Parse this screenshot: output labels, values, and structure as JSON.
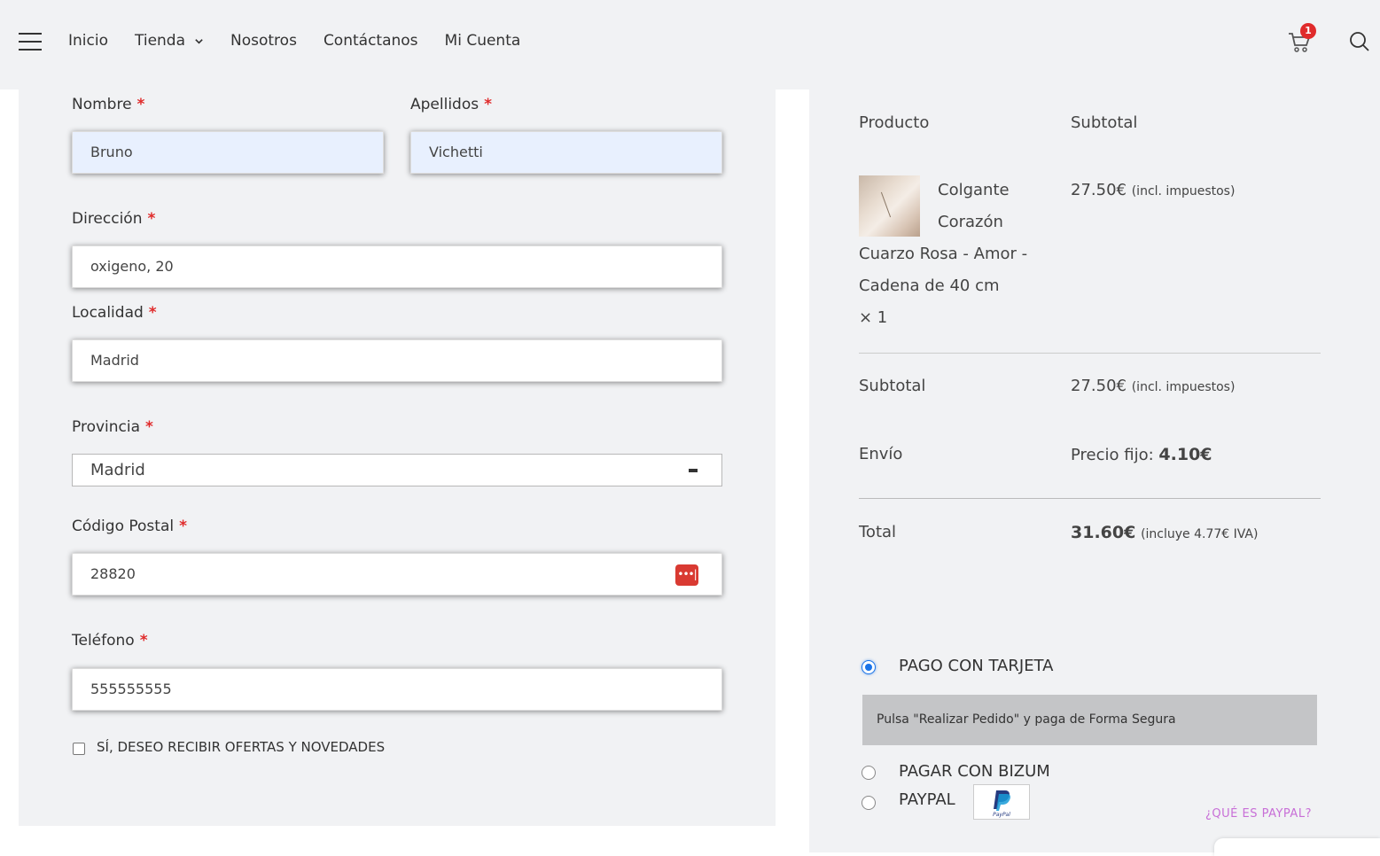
{
  "header": {
    "nav": [
      {
        "label": "Inicio"
      },
      {
        "label": "Tienda"
      },
      {
        "label": "Nosotros"
      },
      {
        "label": "Contáctanos"
      },
      {
        "label": "Mi Cuenta"
      }
    ],
    "cart_count": "1"
  },
  "form": {
    "nombre": {
      "label": "Nombre",
      "value": "Bruno"
    },
    "apellidos": {
      "label": "Apellidos",
      "value": "Vichetti"
    },
    "direccion": {
      "label": "Dirección",
      "value": "oxigeno, 20"
    },
    "localidad": {
      "label": "Localidad",
      "value": "Madrid"
    },
    "provincia": {
      "label": "Provincia",
      "value": "Madrid"
    },
    "codigo_postal": {
      "label": "Código Postal",
      "value": "28820"
    },
    "telefono": {
      "label": "Teléfono",
      "value": "555555555"
    },
    "required_mark": "*",
    "newsletter_label": "SÍ, DESEO RECIBIR OFERTAS Y NOVEDADES",
    "password_icon_text": "•••|"
  },
  "order": {
    "col_product": "Producto",
    "col_subtotal": "Subtotal",
    "product_lines": [
      "Colgante",
      "Corazón",
      "Cuarzo Rosa - Amor -",
      "Cadena de 40 cm"
    ],
    "product_qty": "× 1",
    "product_price": "27.50€",
    "incl_tax": "(incl. impuestos)",
    "subtotal_label": "Subtotal",
    "subtotal_value": "27.50€",
    "shipping_label": "Envío",
    "shipping_prefix": "Precio fijo:",
    "shipping_value": "4.10€",
    "total_label": "Total",
    "total_value": "31.60€",
    "total_tax": "(incluye 4.77€ IVA)"
  },
  "payment": {
    "card_label": "PAGO CON TARJETA",
    "card_desc": "Pulsa \"Realizar Pedido\" y paga de Forma Segura",
    "bizum_label": "PAGAR CON BIZUM",
    "paypal_label": "PAYPAL",
    "paypal_link": "¿QUÉ ES PAYPAL?",
    "paypal_logo_text": "PayPal",
    "selected": "card"
  },
  "colors": {
    "required": "#e02b2b",
    "panel_bg": "#f1f2f4",
    "autofill": "#e8f0fe",
    "link": "#c86fd7",
    "radio": "#1a73e8"
  }
}
